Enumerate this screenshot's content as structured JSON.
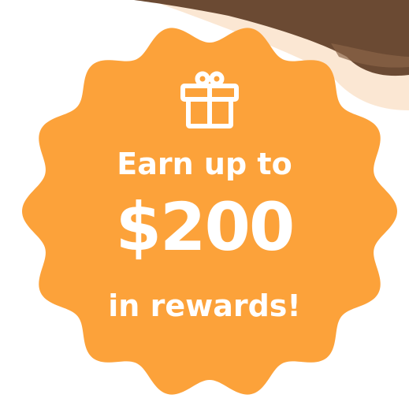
{
  "promo": {
    "headline_top": "Earn up to",
    "amount": "$200",
    "headline_bottom": "in rewards!",
    "icon": "gift-icon"
  },
  "colors": {
    "badge": "#FCA23A",
    "text": "#FFFFFF",
    "photo_skin": "#6B4A33",
    "photo_background": "#FBE7D3"
  }
}
